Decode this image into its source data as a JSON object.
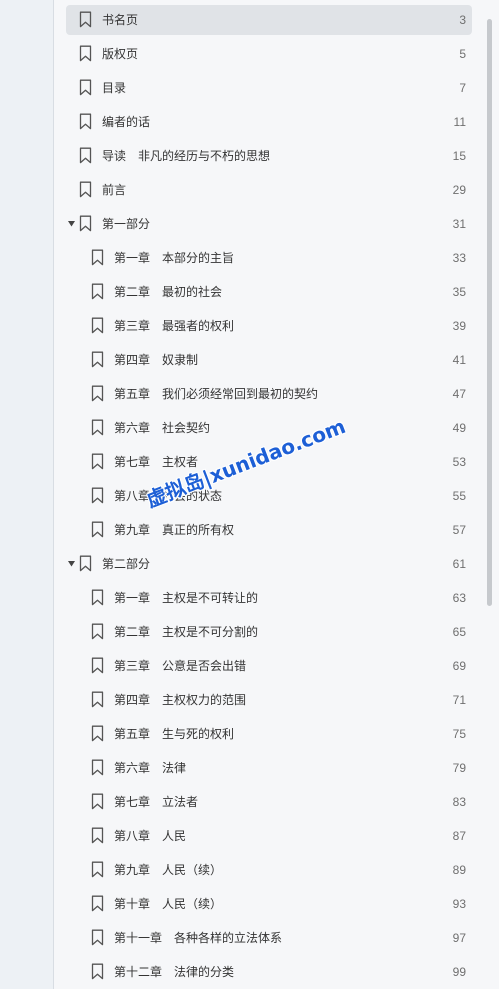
{
  "colors": {
    "selected_bg": "#e0e3e7",
    "title_text": "#333333",
    "page_text": "#6f6f6f",
    "watermark": "#1d5fd6"
  },
  "toc": {
    "items": [
      {
        "label": "书名页",
        "page": "3",
        "level": 0,
        "selected": true
      },
      {
        "label": "版权页",
        "page": "5",
        "level": 0
      },
      {
        "label": "目录",
        "page": "7",
        "level": 0
      },
      {
        "label": "编者的话",
        "page": "11",
        "level": 0
      },
      {
        "label": "导读　非凡的经历与不朽的思想",
        "page": "15",
        "level": 0
      },
      {
        "label": "前言",
        "page": "29",
        "level": 0
      },
      {
        "label": "第一部分",
        "page": "31",
        "level": 0,
        "expandable": true,
        "expanded": true
      },
      {
        "label": "第一章　本部分的主旨",
        "page": "33",
        "level": 1
      },
      {
        "label": "第二章　最初的社会",
        "page": "35",
        "level": 1
      },
      {
        "label": "第三章　最强者的权利",
        "page": "39",
        "level": 1
      },
      {
        "label": "第四章　奴隶制",
        "page": "41",
        "level": 1
      },
      {
        "label": "第五章　我们必须经常回到最初的契约",
        "page": "47",
        "level": 1
      },
      {
        "label": "第六章　社会契约",
        "page": "49",
        "level": 1
      },
      {
        "label": "第七章　主权者",
        "page": "53",
        "level": 1
      },
      {
        "label": "第八章　社会的状态",
        "page": "55",
        "level": 1
      },
      {
        "label": "第九章　真正的所有权",
        "page": "57",
        "level": 1
      },
      {
        "label": "第二部分",
        "page": "61",
        "level": 0,
        "expandable": true,
        "expanded": true
      },
      {
        "label": "第一章　主权是不可转让的",
        "page": "63",
        "level": 1
      },
      {
        "label": "第二章　主权是不可分割的",
        "page": "65",
        "level": 1
      },
      {
        "label": "第三章　公意是否会出错",
        "page": "69",
        "level": 1
      },
      {
        "label": "第四章　主权权力的范围",
        "page": "71",
        "level": 1
      },
      {
        "label": "第五章　生与死的权利",
        "page": "75",
        "level": 1
      },
      {
        "label": "第六章　法律",
        "page": "79",
        "level": 1
      },
      {
        "label": "第七章　立法者",
        "page": "83",
        "level": 1
      },
      {
        "label": "第八章　人民",
        "page": "87",
        "level": 1
      },
      {
        "label": "第九章　人民（续）",
        "page": "89",
        "level": 1
      },
      {
        "label": "第十章　人民（续）",
        "page": "93",
        "level": 1
      },
      {
        "label": "第十一章　各种各样的立法体系",
        "page": "97",
        "level": 1
      },
      {
        "label": "第十二章　法律的分类",
        "page": "99",
        "level": 1
      }
    ]
  },
  "watermark": {
    "text": "虚拟岛|xunidao.com"
  }
}
